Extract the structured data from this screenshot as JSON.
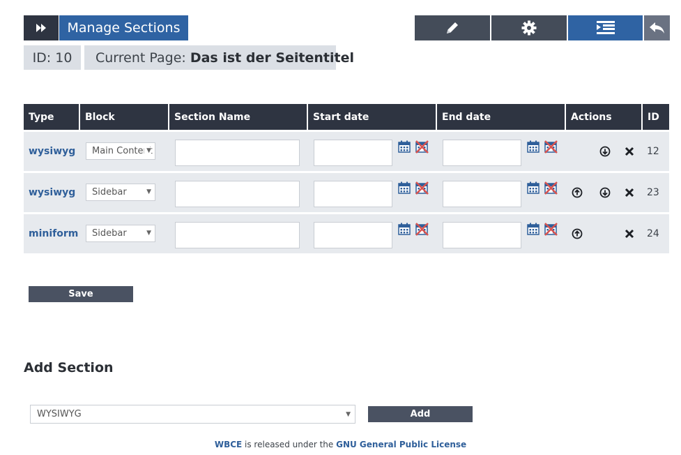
{
  "header": {
    "title": "Manage Sections",
    "toolbar": {
      "icons": [
        "forward-icon",
        "pencil-icon",
        "gear-icon",
        "sections-icon",
        "reply-icon"
      ],
      "active": "sections"
    }
  },
  "info": {
    "id_label": "ID: 10",
    "page_label": "Current Page:",
    "page_title": "Das ist der Seitentitel"
  },
  "table": {
    "headers": [
      "Type",
      "Block",
      "Section Name",
      "Start date",
      "End date",
      "Actions",
      "ID"
    ],
    "rows": [
      {
        "type": "wysiwyg",
        "block": "Main Content",
        "section_name": "",
        "start_date": "",
        "end_date": "",
        "up": false,
        "down": true,
        "delete": true,
        "id": "12"
      },
      {
        "type": "wysiwyg",
        "block": "Sidebar",
        "section_name": "",
        "start_date": "",
        "end_date": "",
        "up": true,
        "down": true,
        "delete": true,
        "id": "23"
      },
      {
        "type": "miniform",
        "block": "Sidebar",
        "section_name": "",
        "start_date": "",
        "end_date": "",
        "up": true,
        "down": false,
        "delete": true,
        "id": "24"
      }
    ]
  },
  "save_label": "Save",
  "add_section": {
    "heading": "Add Section",
    "selected": "WYSIWYG",
    "add_label": "Add"
  },
  "footer": {
    "brand": "WBCE",
    "middle": " is released under the ",
    "license": "GNU General Public License"
  },
  "colors": {
    "dark": "#2e3441",
    "accent": "#2f63a3",
    "row_bg": "#e7eaee",
    "link": "#2f5f9a"
  }
}
